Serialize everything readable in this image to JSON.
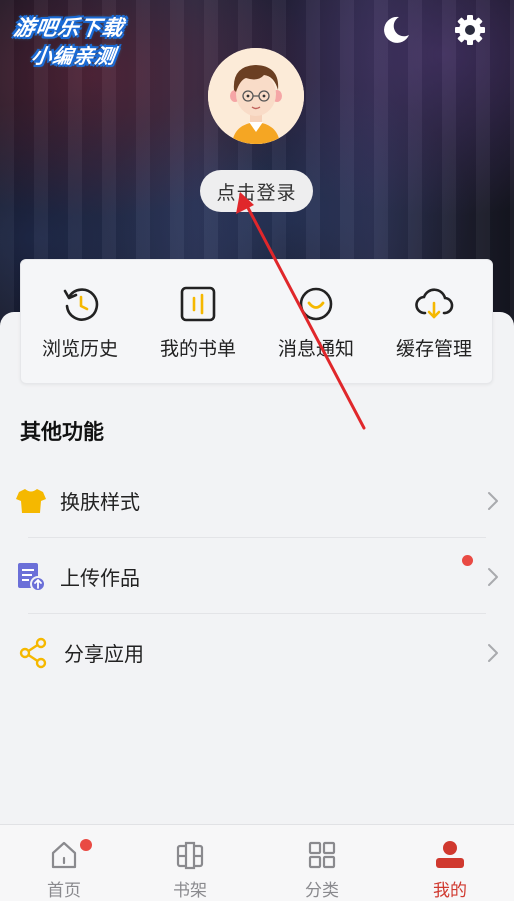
{
  "watermark": {
    "line1": "游吧乐下载",
    "line2": "小编亲测"
  },
  "header": {
    "login_label": "点击登录",
    "icons": [
      "moon-icon",
      "settings-gear-icon"
    ]
  },
  "quick_actions": [
    {
      "label": "浏览历史",
      "icon": "history-clock-icon"
    },
    {
      "label": "我的书单",
      "icon": "book-list-icon"
    },
    {
      "label": "消息通知",
      "icon": "message-smile-icon"
    },
    {
      "label": "缓存管理",
      "icon": "cloud-download-icon"
    }
  ],
  "other_functions": {
    "title": "其他功能",
    "items": [
      {
        "label": "换肤样式",
        "icon": "tshirt-icon",
        "badge": false
      },
      {
        "label": "上传作品",
        "icon": "upload-document-icon",
        "badge": true
      },
      {
        "label": "分享应用",
        "icon": "share-icon",
        "badge": false
      }
    ]
  },
  "bottom_nav": [
    {
      "label": "首页",
      "icon": "home-icon",
      "badge": true,
      "active": false
    },
    {
      "label": "书架",
      "icon": "bookshelf-icon",
      "badge": false,
      "active": false
    },
    {
      "label": "分类",
      "icon": "category-grid-icon",
      "badge": false,
      "active": false
    },
    {
      "label": "我的",
      "icon": "profile-person-icon",
      "badge": false,
      "active": true
    }
  ],
  "colors": {
    "accent": "#d0392f",
    "badge": "#e94a43",
    "icon_yellow": "#f5b800",
    "icon_purple": "#6b6fd8"
  }
}
